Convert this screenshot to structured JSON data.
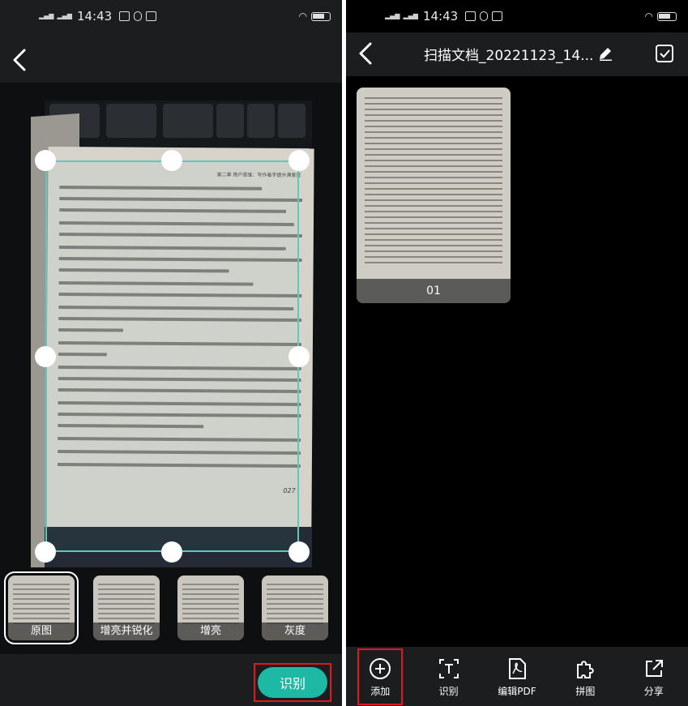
{
  "status": {
    "time": "14:43",
    "signal_text": "4G HD"
  },
  "left": {
    "filters": [
      {
        "label": "原图",
        "selected": true
      },
      {
        "label": "增亮并锐化",
        "selected": false
      },
      {
        "label": "增亮",
        "selected": false
      },
      {
        "label": "灰度",
        "selected": false
      }
    ],
    "recognize_button": "识别",
    "page_header": "第二章 用户思维：写作着手提升满意度",
    "page_number": "027"
  },
  "right": {
    "title": "扫描文档_20221123_14...",
    "thumbnail_label": "01",
    "toolbar": [
      {
        "label": "添加",
        "icon": "add-circle-icon"
      },
      {
        "label": "识别",
        "icon": "text-recognize-icon"
      },
      {
        "label": "编辑PDF",
        "icon": "pdf-icon"
      },
      {
        "label": "拼图",
        "icon": "puzzle-icon"
      },
      {
        "label": "分享",
        "icon": "share-icon"
      }
    ]
  },
  "colors": {
    "accent": "#1eb9a4",
    "crop_line": "#5fc8bd",
    "highlight": "#e0181e"
  }
}
